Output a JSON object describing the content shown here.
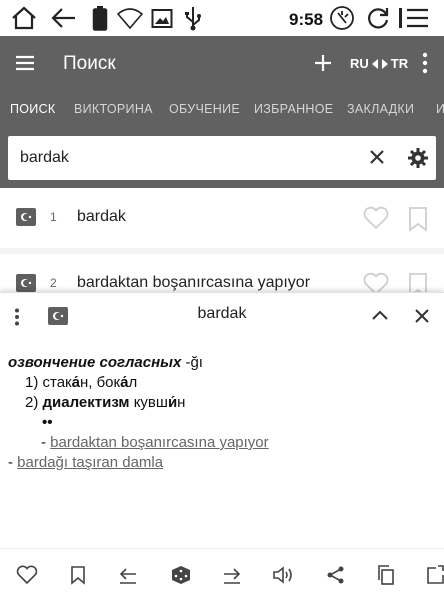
{
  "status_bar": {
    "time": "9:58",
    "icons": [
      "home-icon",
      "back-arrow-icon",
      "battery-icon",
      "wifi-icon",
      "image-icon",
      "usb-icon",
      "cleanup-icon",
      "refresh-icon",
      "menu-lines-icon"
    ]
  },
  "app_bar": {
    "title": "Поиск",
    "add_icon": "plus-icon",
    "lang_from": "RU",
    "lang_to": "TR",
    "more_icon": "more-vertical-icon"
  },
  "tabs": [
    {
      "label": "ПОИСК",
      "active": true
    },
    {
      "label": "ВИКТОРИНА",
      "active": false
    },
    {
      "label": "ОБУЧЕНИЕ",
      "active": false
    },
    {
      "label": "ИЗБРАННОЕ",
      "active": false
    },
    {
      "label": "ЗАКЛАДКИ",
      "active": false
    },
    {
      "label": "И",
      "active": false
    }
  ],
  "search": {
    "value": "bardak"
  },
  "results": [
    {
      "index": "1",
      "word": "bardak"
    },
    {
      "index": "2",
      "word": "bardaktan boşanırcasına yapıyor"
    }
  ],
  "detail": {
    "title": "bardak",
    "grammar_label": "озвончение согласных",
    "suffix": " -ğı",
    "sense1_num": "1)",
    "sense1_a": " стак",
    "sense1_a_stress": "а́",
    "sense1_b": "н, бок",
    "sense1_b_stress": "а́",
    "sense1_c": "л",
    "sense2_num": "2)",
    "sense2_label": "диалектизм",
    "sense2_a": " кувш",
    "sense2_a_stress": "и́",
    "sense2_b": "н",
    "bullets": "••",
    "phrase1_prefix": "- ",
    "phrase1": "bardaktan boşanırcasına yapıyor",
    "phrase2_prefix": "- ",
    "phrase2": "bardağı taşıran damla"
  },
  "bottom_bar": {
    "icons": [
      "heart-icon",
      "bookmark-icon",
      "previous-icon",
      "random-dice-icon",
      "next-icon",
      "speaker-icon",
      "share-icon",
      "copy-icon",
      "open-external-icon"
    ]
  },
  "colors": {
    "app_bar": "#616161",
    "active_tab": "#ffffff",
    "inactive_tab": "#d5d5d5"
  }
}
